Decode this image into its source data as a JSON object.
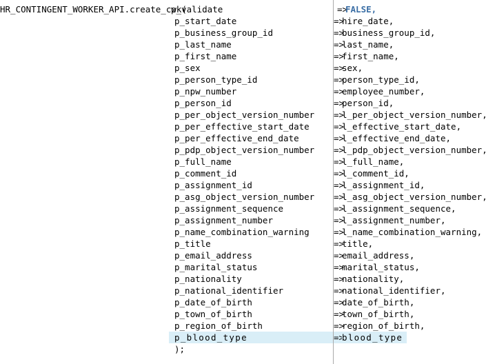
{
  "editor": {
    "title": "HR_CONTINGENT_WORKER_API.create_cwk",
    "divider_color": "#a9a9a9",
    "background_color": "#ffffff",
    "text_color": "#000000",
    "keyword_color": "#3a6ea5",
    "highlight_color": "#d9eef7"
  },
  "code": {
    "header_prefix": "HR_CONTINGENT_WORKER_API.create_cwk(",
    "closing_line": ");",
    "arrow": "=>",
    "lines": [
      {
        "param": "p_validate",
        "arrow": "=>",
        "value": "FALSE,",
        "keyword": true,
        "highlighted": false
      },
      {
        "param": "p_start_date",
        "arrow": "=>",
        "value": "hire_date,",
        "keyword": false,
        "highlighted": false
      },
      {
        "param": "p_business_group_id",
        "arrow": "=>",
        "value": "business_group_id,",
        "keyword": false,
        "highlighted": false
      },
      {
        "param": "p_last_name",
        "arrow": "=>",
        "value": "last_name,",
        "keyword": false,
        "highlighted": false
      },
      {
        "param": "p_first_name",
        "arrow": "=>",
        "value": "first_name,",
        "keyword": false,
        "highlighted": false
      },
      {
        "param": "p_sex",
        "arrow": "=>",
        "value": "sex,",
        "keyword": false,
        "highlighted": false
      },
      {
        "param": "p_person_type_id",
        "arrow": "=>",
        "value": "person_type_id,",
        "keyword": false,
        "highlighted": false
      },
      {
        "param": "p_npw_number",
        "arrow": "=>",
        "value": "employee_number,",
        "keyword": false,
        "highlighted": false
      },
      {
        "param": "p_person_id",
        "arrow": "=>",
        "value": "person_id,",
        "keyword": false,
        "highlighted": false
      },
      {
        "param": "p_per_object_version_number",
        "arrow": "=>",
        "value": "l_per_object_version_number,",
        "keyword": false,
        "highlighted": false
      },
      {
        "param": "p_per_effective_start_date",
        "arrow": "=>",
        "value": "l_effective_start_date,",
        "keyword": false,
        "highlighted": false
      },
      {
        "param": "p_per_effective_end_date",
        "arrow": "=>",
        "value": "l_effective_end_date,",
        "keyword": false,
        "highlighted": false
      },
      {
        "param": "p_pdp_object_version_number",
        "arrow": "=>",
        "value": "l_pdp_object_version_number,",
        "keyword": false,
        "highlighted": false
      },
      {
        "param": "p_full_name",
        "arrow": "=>",
        "value": "l_full_name,",
        "keyword": false,
        "highlighted": false
      },
      {
        "param": "p_comment_id",
        "arrow": "=>",
        "value": "l_comment_id,",
        "keyword": false,
        "highlighted": false
      },
      {
        "param": "p_assignment_id",
        "arrow": "=>",
        "value": "l_assignment_id,",
        "keyword": false,
        "highlighted": false
      },
      {
        "param": "p_asg_object_version_number",
        "arrow": "=>",
        "value": "l_asg_object_version_number,",
        "keyword": false,
        "highlighted": false
      },
      {
        "param": "p_assignment_sequence",
        "arrow": "=>",
        "value": "l_assignment_sequence,",
        "keyword": false,
        "highlighted": false
      },
      {
        "param": "p_assignment_number",
        "arrow": "=>",
        "value": "l_assignment_number,",
        "keyword": false,
        "highlighted": false
      },
      {
        "param": "p_name_combination_warning",
        "arrow": "=>",
        "value": "l_name_combination_warning,",
        "keyword": false,
        "highlighted": false
      },
      {
        "param": "p_title",
        "arrow": "=>",
        "value": "title,",
        "keyword": false,
        "highlighted": false
      },
      {
        "param": "p_email_address",
        "arrow": "=>",
        "value": "email_address,",
        "keyword": false,
        "highlighted": false
      },
      {
        "param": "p_marital_status",
        "arrow": "=>",
        "value": "marital_status,",
        "keyword": false,
        "highlighted": false
      },
      {
        "param": "p_nationality",
        "arrow": "=>",
        "value": "nationality,",
        "keyword": false,
        "highlighted": false
      },
      {
        "param": "p_national_identifier",
        "arrow": "=>",
        "value": "national_identifier,",
        "keyword": false,
        "highlighted": false
      },
      {
        "param": "p_date_of_birth",
        "arrow": "=>",
        "value": "date_of_birth,",
        "keyword": false,
        "highlighted": false
      },
      {
        "param": "p_town_of_birth",
        "arrow": "=>",
        "value": "town_of_birth,",
        "keyword": false,
        "highlighted": false
      },
      {
        "param": "p_region_of_birth",
        "arrow": "=>",
        "value": "region_of_birth,",
        "keyword": false,
        "highlighted": false
      },
      {
        "param": "p_blood_type",
        "arrow": "=>",
        "value": "blood_type",
        "keyword": false,
        "highlighted": true
      }
    ]
  }
}
